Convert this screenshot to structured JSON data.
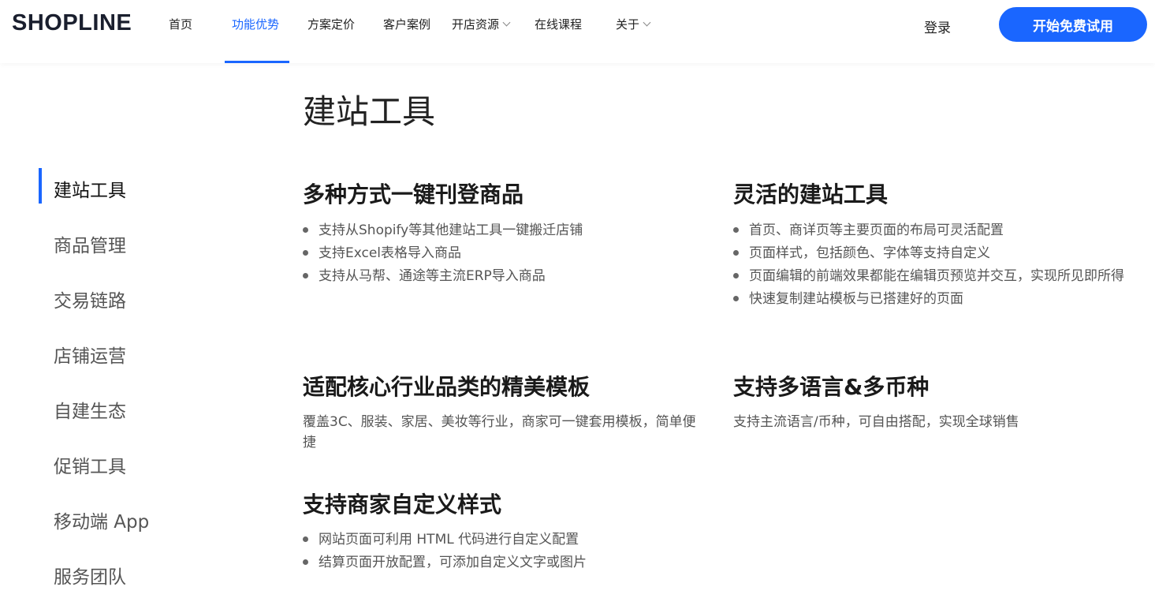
{
  "header": {
    "logo_text": "SHOPLINE",
    "nav": [
      {
        "label": "首页",
        "dropdown": false,
        "active": false
      },
      {
        "label": "功能优势",
        "dropdown": false,
        "active": true
      },
      {
        "label": "方案定价",
        "dropdown": false,
        "active": false
      },
      {
        "label": "客户案例",
        "dropdown": false,
        "active": false
      },
      {
        "label": "开店资源",
        "dropdown": true,
        "active": false
      },
      {
        "label": "在线课程",
        "dropdown": false,
        "active": false
      },
      {
        "label": "关于",
        "dropdown": true,
        "active": false
      }
    ],
    "login_label": "登录",
    "cta_label": "开始免费试用"
  },
  "colors": {
    "accent": "#1a66ff",
    "text": "#222222",
    "muted": "#555555"
  },
  "page_title": "建站工具",
  "sidebar": {
    "items": [
      {
        "label": "建站工具",
        "active": true
      },
      {
        "label": "商品管理",
        "active": false
      },
      {
        "label": "交易链路",
        "active": false
      },
      {
        "label": "店铺运营",
        "active": false
      },
      {
        "label": "自建生态",
        "active": false
      },
      {
        "label": "促销工具",
        "active": false
      },
      {
        "label": "移动端 App",
        "active": false
      },
      {
        "label": "服务团队",
        "active": false
      }
    ]
  },
  "sections": {
    "multi_listing": {
      "title": "多种方式一键刊登商品",
      "bullets": [
        "支持从Shopify等其他建站工具一键搬迁店铺",
        "支持Excel表格导入商品",
        "支持从马帮、通途等主流ERP导入商品"
      ]
    },
    "flexible_builder": {
      "title": "灵活的建站工具",
      "bullets": [
        "首页、商详页等主要页面的布局可灵活配置",
        "页面样式，包括颜色、字体等支持自定义",
        "页面编辑的前端效果都能在编辑页预览并交互，实现所见即所得",
        "快速复制建站模板与已搭建好的页面"
      ]
    },
    "templates": {
      "title": "适配核心行业品类的精美模板",
      "description": "覆盖3C、服装、家居、美妆等行业，商家可一键套用模板，简单便捷"
    },
    "multi_language": {
      "title": "支持多语言&多币种",
      "description": "支持主流语言/币种，可自由搭配，实现全球销售"
    },
    "custom_style": {
      "title": "支持商家自定义样式",
      "bullets": [
        "网站页面可利用 HTML 代码进行自定义配置",
        "结算页面开放配置，可添加自定义文字或图片"
      ]
    }
  }
}
